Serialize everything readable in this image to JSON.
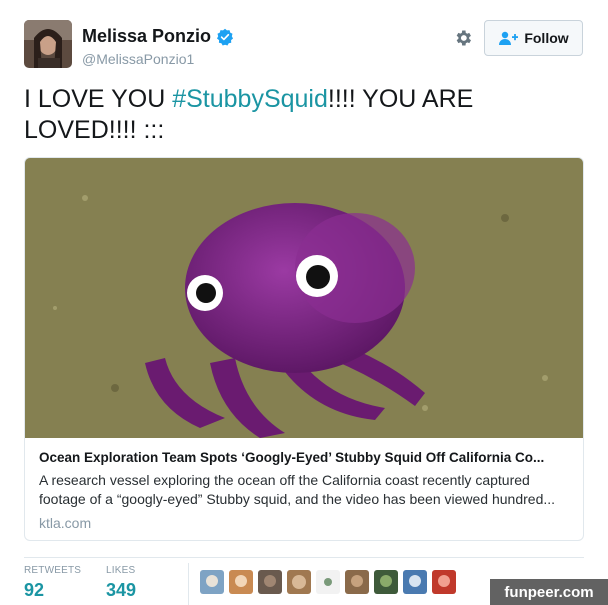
{
  "user": {
    "display_name": "Melissa Ponzio",
    "handle": "@MelissaPonzio1",
    "verified": true
  },
  "actions": {
    "follow_label": "Follow"
  },
  "tweet": {
    "text_before": "I LOVE YOU ",
    "hashtag": "#StubbySquid",
    "text_after": "!!!! YOU ARE LOVED!!!! :::"
  },
  "card": {
    "title": "Ocean Exploration Team Spots ‘Googly-Eyed’ Stubby Squid Off California Co...",
    "description": "A research vessel exploring the ocean off the California coast recently captured footage of a “googly-eyed” Stubby squid, and the video has been viewed hundred...",
    "domain": "ktla.com"
  },
  "stats": {
    "retweets_label": "RETWEETS",
    "retweets_value": "92",
    "likes_label": "LIKES",
    "likes_value": "349"
  },
  "likers_count": 9,
  "watermark": "funpeer.com",
  "colors": {
    "accent": "#1b95a3",
    "verified": "#1da1f2",
    "text": "#14171a",
    "muted": "#8899a6"
  },
  "icons": [
    "verified-badge-icon",
    "gear-icon",
    "follow-person-plus-icon"
  ]
}
